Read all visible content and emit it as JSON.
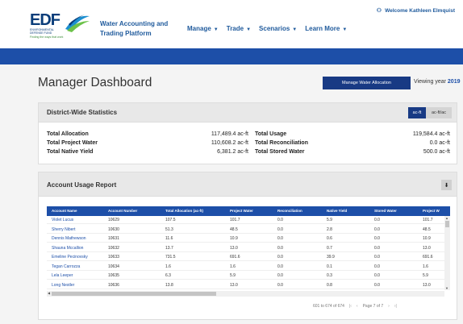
{
  "header": {
    "logo_text": "EDF",
    "logo_subtitle": "ENVIRONMENTAL DEFENSE FUND",
    "logo_tagline": "Finding the ways that work",
    "app_title": "Water Accounting and Trading Platform",
    "nav": [
      {
        "label": "Manage"
      },
      {
        "label": "Trade"
      },
      {
        "label": "Scenarios"
      },
      {
        "label": "Learn More"
      }
    ],
    "welcome": "Welcome Kathleen Elmquist"
  },
  "dashboard": {
    "title": "Manager Dashboard",
    "manage_button": "Manage Water Allocation",
    "viewing_label": "Viewing year",
    "viewing_year": "2019"
  },
  "stats": {
    "title": "District-Wide Statistics",
    "unit_active": "ac-ft",
    "unit_alt": "ac-ft/ac",
    "items": [
      {
        "label": "Total Allocation",
        "value": "117,489.4 ac-ft"
      },
      {
        "label": "Total Project Water",
        "value": "110,608.2 ac-ft"
      },
      {
        "label": "Total Native Yield",
        "value": "6,381.2 ac-ft"
      },
      {
        "label": "Total Usage",
        "value": "119,584.4 ac-ft"
      },
      {
        "label": "Total Reconciliation",
        "value": "0.0 ac-ft"
      },
      {
        "label": "Total Stored Water",
        "value": "500.0 ac-ft"
      }
    ]
  },
  "report": {
    "title": "Account Usage Report",
    "columns": [
      "Account Name",
      "Account Number",
      "Total Allocation (ac-ft)",
      "Project Water",
      "Reconciliation",
      "Native Yield",
      "Stored Water",
      "Project W"
    ],
    "rows": [
      [
        "Violet Lucus",
        "10629",
        "107.5",
        "101.7",
        "0.0",
        "5.9",
        "0.0",
        "101.7"
      ],
      [
        "Sherry Nibert",
        "10630",
        "51.3",
        "48.5",
        "0.0",
        "2.8",
        "0.0",
        "48.5"
      ],
      [
        "Dennis Mathewson",
        "10631",
        "11.6",
        "10.9",
        "0.0",
        "0.6",
        "0.0",
        "10.9"
      ],
      [
        "Shauna Mccallion",
        "10632",
        "13.7",
        "13.0",
        "0.0",
        "0.7",
        "0.0",
        "13.0"
      ],
      [
        "Emeline Pecinovsky",
        "10633",
        "731.5",
        "691.6",
        "0.0",
        "39.9",
        "0.0",
        "691.6"
      ],
      [
        "Tegan Carrozza",
        "10634",
        "1.6",
        "1.6",
        "0.0",
        "0.1",
        "0.0",
        "1.6"
      ],
      [
        "Lela Leeper",
        "10635",
        "6.3",
        "5.9",
        "0.0",
        "0.3",
        "0.0",
        "5.9"
      ],
      [
        "Long Nestler",
        "10636",
        "13.8",
        "13.0",
        "0.0",
        "0.8",
        "0.0",
        "13.0"
      ]
    ],
    "pager_range": "601 to 674 of 674",
    "pager_page": "Page 7 of 7"
  }
}
